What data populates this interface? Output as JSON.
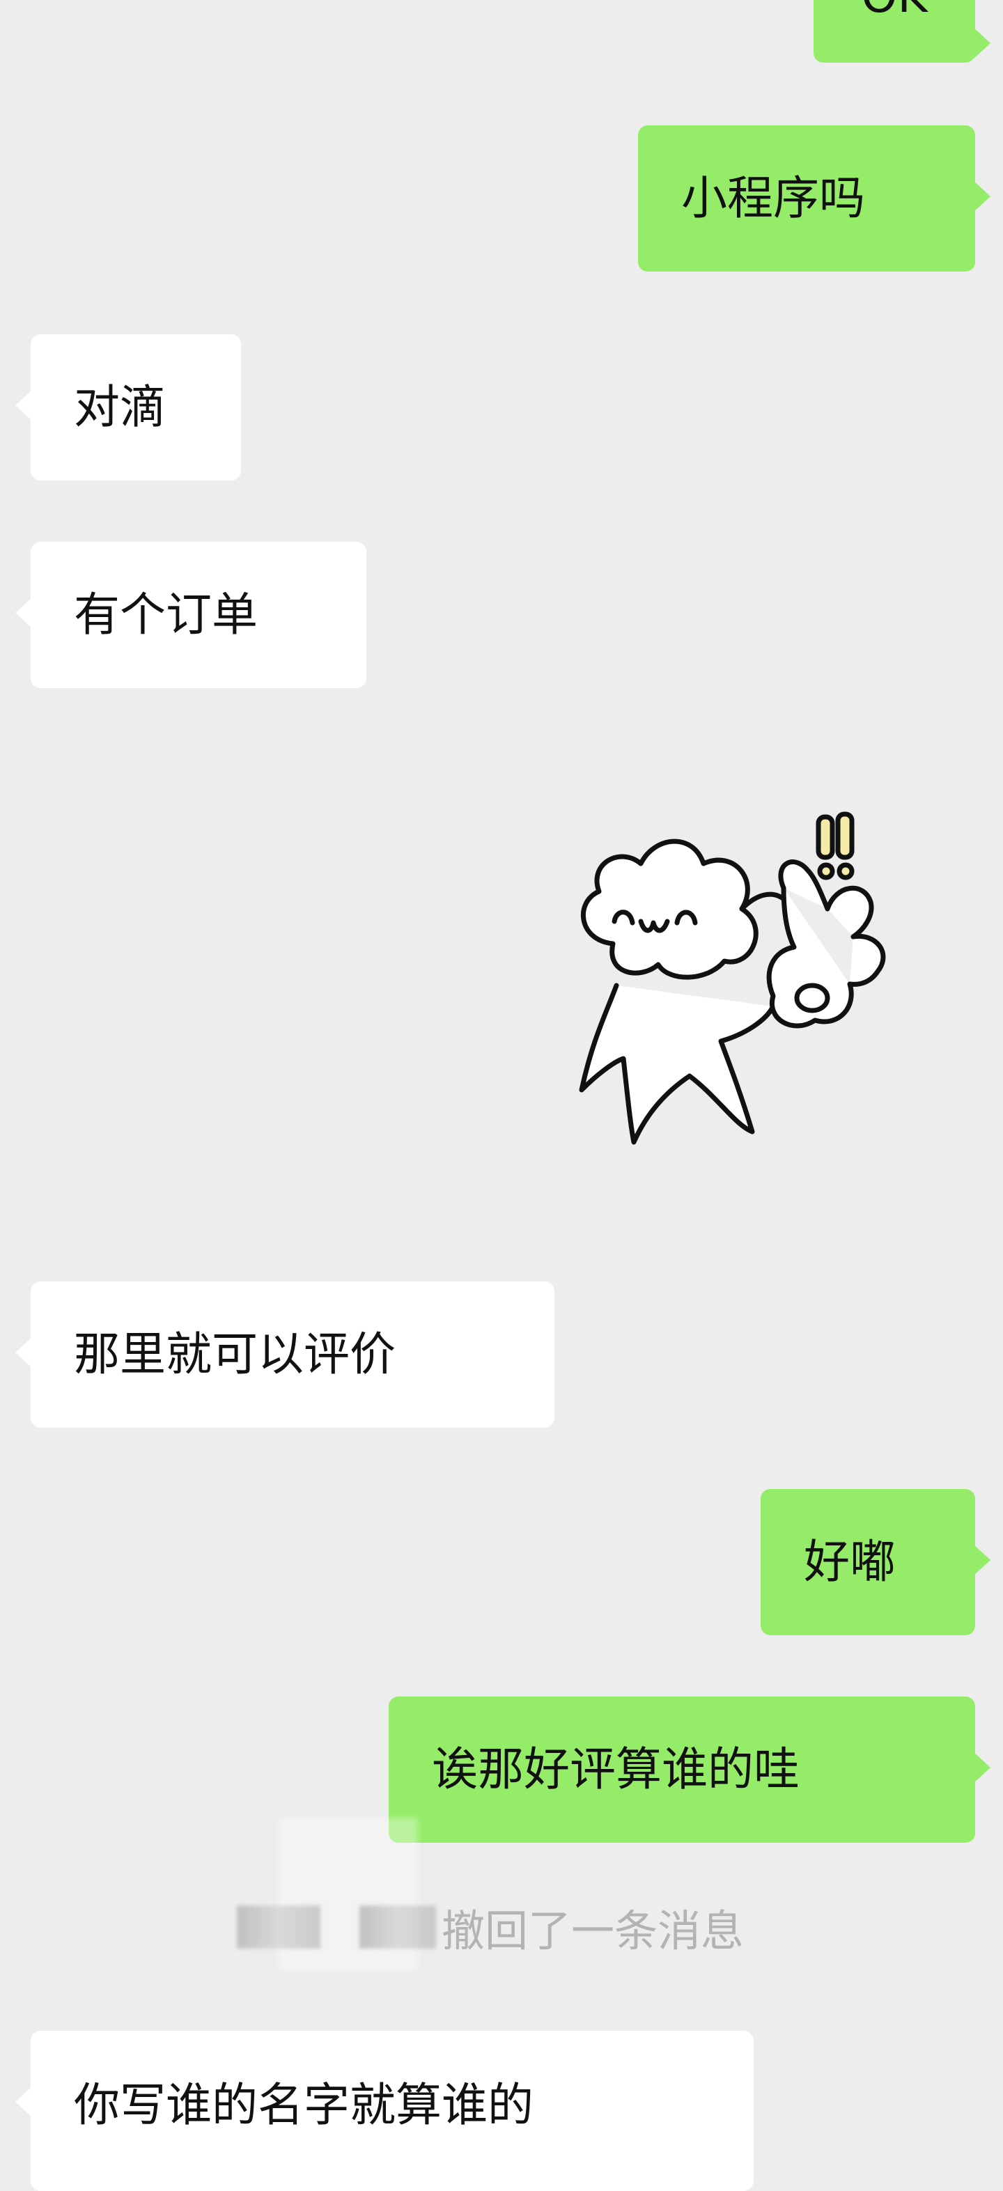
{
  "messages": [
    {
      "id": "m1",
      "side": "outgoing",
      "text": "OK"
    },
    {
      "id": "m2",
      "side": "outgoing",
      "text": "小程序吗"
    },
    {
      "id": "m3",
      "side": "incoming",
      "text": "对滴"
    },
    {
      "id": "m4",
      "side": "incoming",
      "text": "有个订单"
    },
    {
      "id": "m5",
      "side": "outgoing",
      "type": "sticker",
      "sticker": "cartoon-peace-sign-icon"
    },
    {
      "id": "m6",
      "side": "incoming",
      "text": "那里就可以评价"
    },
    {
      "id": "m7",
      "side": "outgoing",
      "text": "好嘟"
    },
    {
      "id": "m8",
      "side": "outgoing",
      "text": "诶那好评算谁的哇"
    },
    {
      "id": "m9",
      "type": "system",
      "text": "撤回了一条消息"
    },
    {
      "id": "m10",
      "side": "incoming",
      "text": "你写谁的名字就算谁的"
    }
  ],
  "colors": {
    "background": "#ededed",
    "incoming_bubble": "#ffffff",
    "outgoing_bubble": "#95ec69",
    "system_text": "#b3b3b3"
  }
}
